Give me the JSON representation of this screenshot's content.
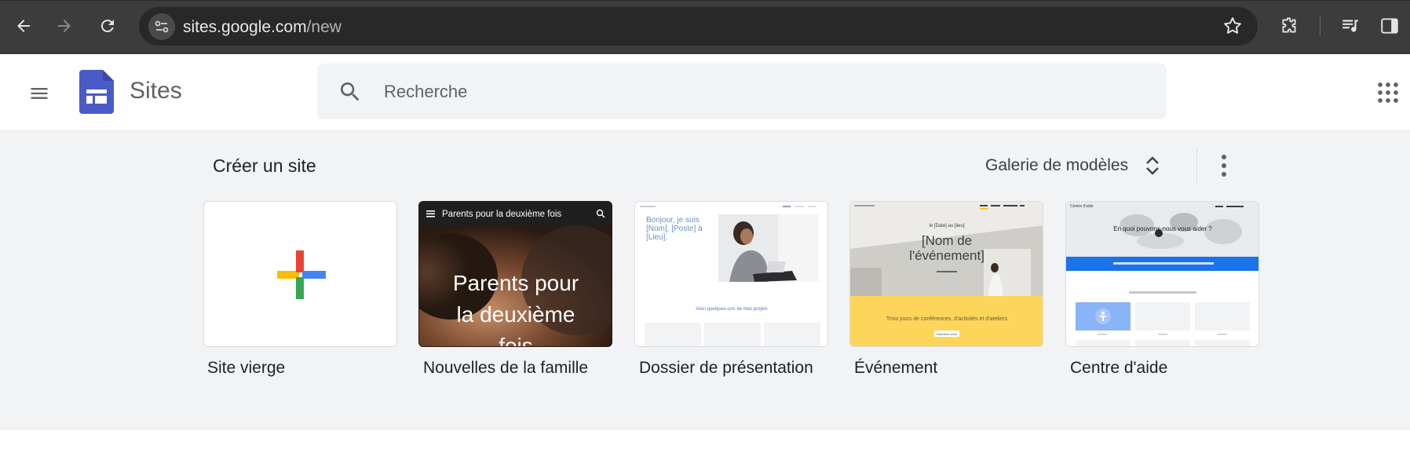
{
  "browser": {
    "url_host": "sites.google.com",
    "url_path": "/new",
    "icons": [
      "back-icon",
      "forward-icon",
      "reload-icon",
      "site-info-icon",
      "bookmark-star-icon",
      "extensions-icon",
      "media-queue-icon",
      "side-panel-icon"
    ]
  },
  "header": {
    "app_name": "Sites",
    "search_placeholder": "Recherche",
    "colors": {
      "sites_blue": "#4a5ac7",
      "sites_dark": "#3848b0"
    }
  },
  "gallery": {
    "title": "Créer un site",
    "toggle_label": "Galerie de modèles",
    "templates": [
      {
        "label": "Site vierge"
      },
      {
        "label": "Nouvelles de la famille",
        "preview_title": "Parents pour la deuxième fois",
        "preview_hero": [
          "Parents pour",
          "la deuxième",
          "fois"
        ]
      },
      {
        "label": "Dossier de présentation",
        "preview_intro": [
          "Bonjour, je suis",
          "[Nom], [Poste] à",
          "[Lieu]."
        ],
        "preview_link": "Voici quelques-uns de mes projets"
      },
      {
        "label": "Événement",
        "preview_date": "le [Date] au [lieu]",
        "preview_title": [
          "[Nom de",
          "l'événement]"
        ],
        "preview_tagline": "Trois jours de conférences, d'activités et d'ateliers",
        "preview_button": "Inscrivez-vous"
      },
      {
        "label": "Centre d'aide",
        "preview_brand": "Centre d'aide",
        "preview_question": "En quoi pouvons-nous vous aider ?"
      }
    ],
    "plus_colors": {
      "red": "#ea4335",
      "blue": "#4285f4",
      "green": "#34a853",
      "yellow": "#fbbc04"
    }
  }
}
